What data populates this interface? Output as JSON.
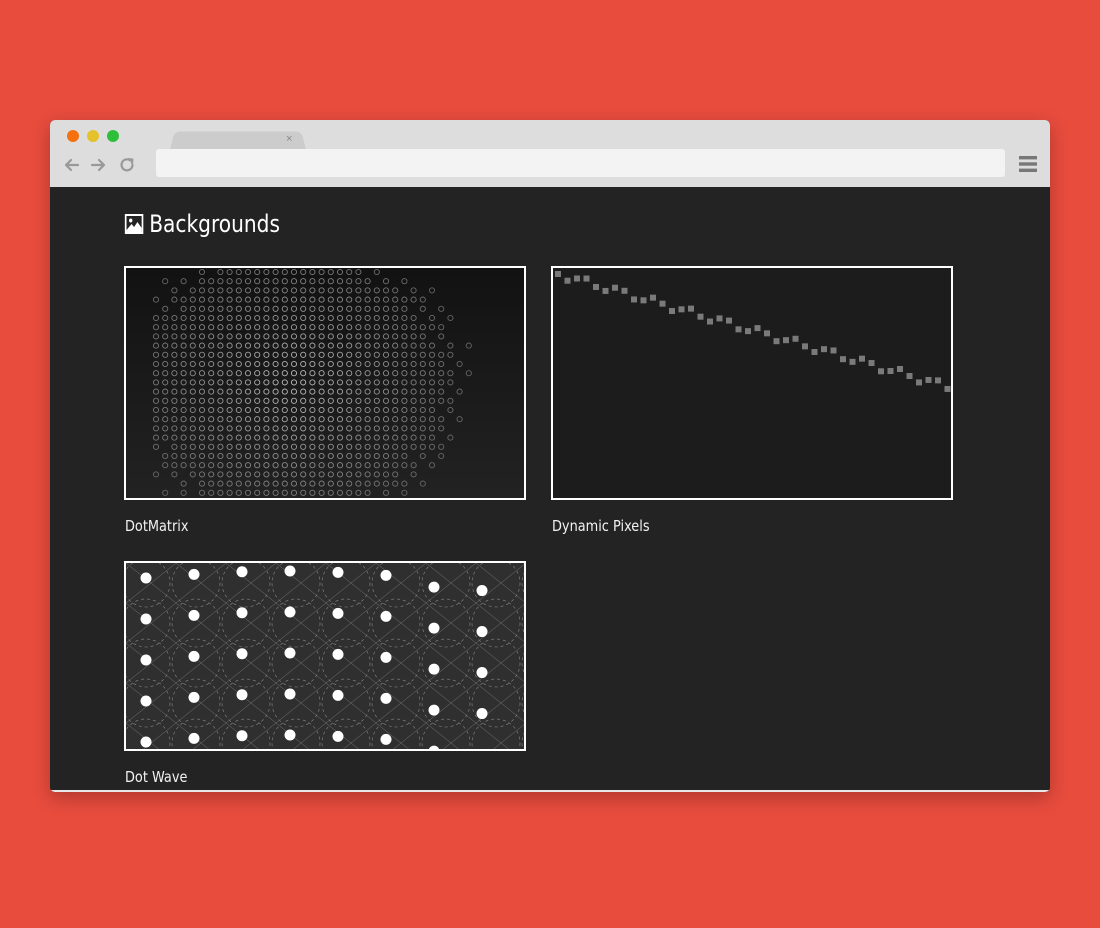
{
  "browser": {
    "tab_close": "×",
    "address_value": "",
    "traffic_light_colors": {
      "close": "#f5700e",
      "minimize": "#e5c12b",
      "maximize": "#2fbe3c"
    }
  },
  "page": {
    "heading_icon": "image-icon",
    "heading": "Backgrounds",
    "background_color": "#e84c3d",
    "cards": [
      {
        "label": "DotMatrix",
        "preview": "dot-matrix-preview"
      },
      {
        "label": "Dynamic Pixels",
        "preview": "dynamic-pixels-preview"
      },
      {
        "label": "Dot Wave",
        "preview": "dot-wave-preview"
      }
    ]
  }
}
